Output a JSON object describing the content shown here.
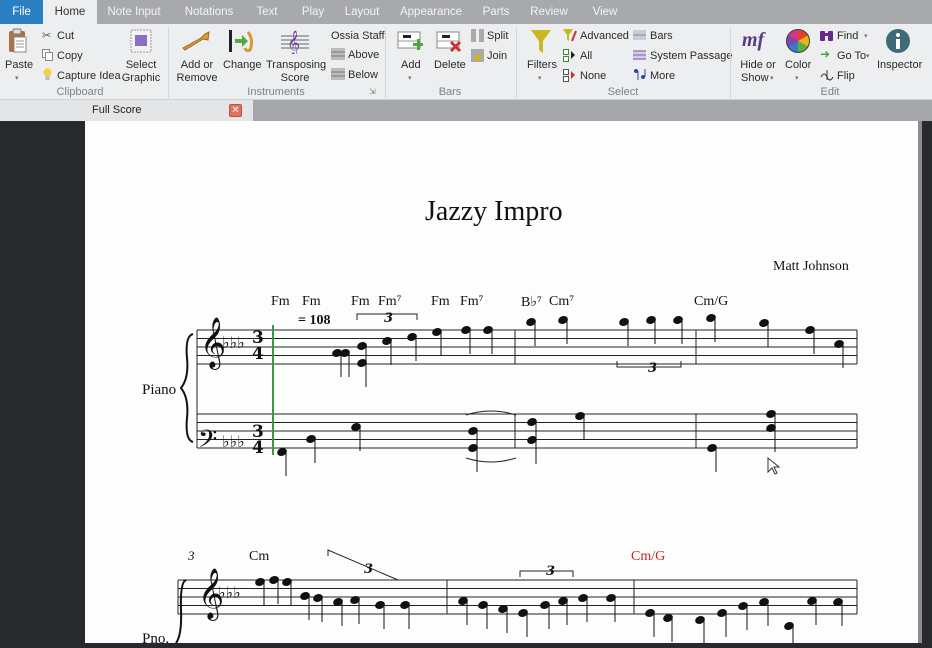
{
  "tabs": [
    {
      "label": "File"
    },
    {
      "label": "Home"
    },
    {
      "label": "Note Input"
    },
    {
      "label": "Notations"
    },
    {
      "label": "Text"
    },
    {
      "label": "Play"
    },
    {
      "label": "Layout"
    },
    {
      "label": "Appearance"
    },
    {
      "label": "Parts"
    },
    {
      "label": "Review"
    },
    {
      "label": "View"
    }
  ],
  "ribbon": {
    "clipboard": {
      "label": "Clipboard",
      "paste": "Paste",
      "cut": "Cut",
      "copy": "Copy",
      "capture": "Capture Idea",
      "select_graphic_1": "Select",
      "select_graphic_2": "Graphic"
    },
    "instruments": {
      "label": "Instruments",
      "add_1": "Add or",
      "add_2": "Remove",
      "change": "Change",
      "transposing_1": "Transposing",
      "transposing_2": "Score",
      "ossia": "Ossia Staff",
      "above": "Above",
      "below": "Below"
    },
    "bars": {
      "label": "Bars",
      "add": "Add",
      "delete": "Delete",
      "split": "Split",
      "join": "Join"
    },
    "select": {
      "label": "Select",
      "filters": "Filters",
      "advanced": "Advanced",
      "all": "All",
      "none": "None",
      "bars": "Bars",
      "system_passage": "System Passage",
      "more": "More"
    },
    "edit": {
      "label": "Edit",
      "hide_1": "Hide or",
      "hide_2": "Show",
      "color": "Color",
      "find": "Find",
      "goto": "Go To",
      "flip": "Flip",
      "inspector": "Inspector"
    }
  },
  "document_tab": {
    "label": "Full Score"
  },
  "score": {
    "title": "Jazzy Impro",
    "composer": "Matt Johnson",
    "instrument": "Piano",
    "instrument_short": "Pno.",
    "tempo": "= 108",
    "time_sig": "3/4",
    "tuplet": "3",
    "system2_bar_number": "3",
    "chords_system1": [
      {
        "text": "Fm"
      },
      {
        "text": "Fm"
      },
      {
        "text": "Fm"
      },
      {
        "text": "Fm⁷"
      },
      {
        "text": "Fm"
      },
      {
        "text": "Fm⁷"
      },
      {
        "text": "B♭⁷"
      },
      {
        "text": "Cm⁷"
      },
      {
        "text": "Cm/G"
      }
    ],
    "chords_system2": [
      {
        "text": "Cm"
      },
      {
        "text": "Cm/G",
        "color": "#c0272d"
      }
    ]
  }
}
